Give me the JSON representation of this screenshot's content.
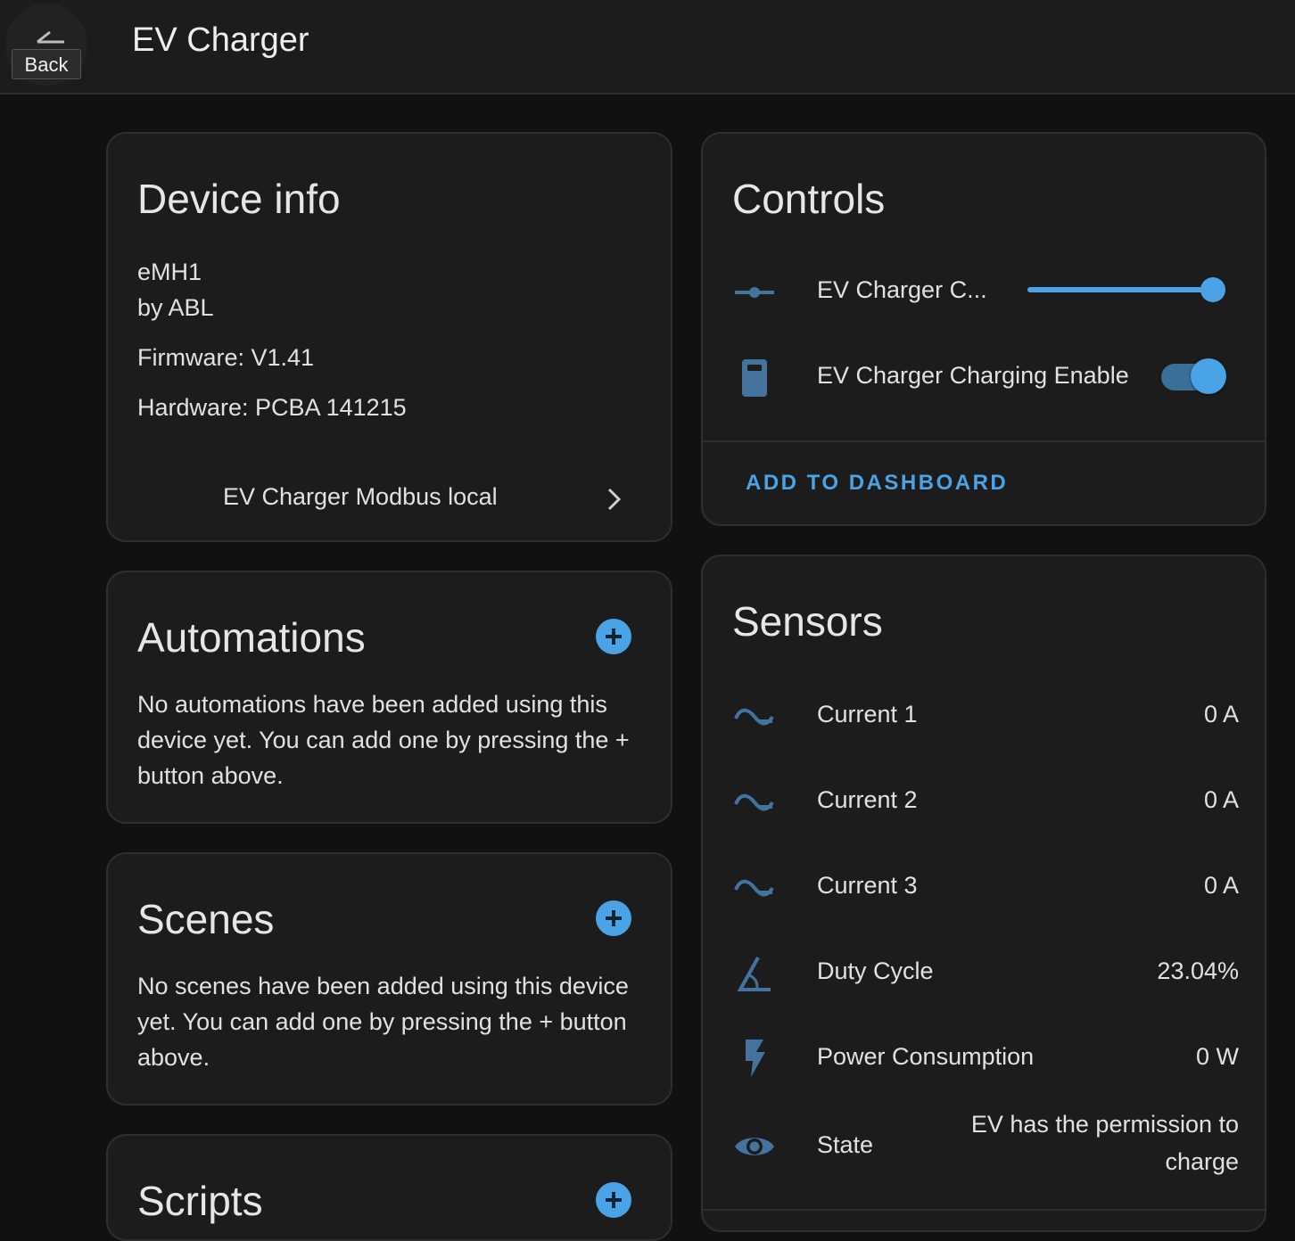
{
  "header": {
    "back_label": "Back",
    "title": "EV Charger"
  },
  "device_info": {
    "title": "Device info",
    "model": "eMH1",
    "manufacturer": "by ABL",
    "firmware": "Firmware: V1.41",
    "hardware": "Hardware: PCBA 141215",
    "integration_link": "EV Charger Modbus local"
  },
  "automations": {
    "title": "Automations",
    "empty_text": "No automations have been added using this device yet. You can add one by pressing the + button above."
  },
  "scenes": {
    "title": "Scenes",
    "empty_text": "No scenes have been added using this device yet. You can add one by pressing the + button above."
  },
  "scripts": {
    "title": "Scripts"
  },
  "controls": {
    "title": "Controls",
    "items": [
      {
        "label": "EV Charger C...",
        "type": "slider",
        "icon": "slider-icon",
        "level": 1.0
      },
      {
        "label": "EV Charger Charging Enable",
        "type": "toggle",
        "icon": "charger-station-icon",
        "state": "on"
      }
    ],
    "add_to_dashboard": "ADD TO DASHBOARD"
  },
  "sensors": {
    "title": "Sensors",
    "items": [
      {
        "label": "Current 1",
        "value": "0 A",
        "icon": "current-ac-icon"
      },
      {
        "label": "Current 2",
        "value": "0 A",
        "icon": "current-ac-icon"
      },
      {
        "label": "Current 3",
        "value": "0 A",
        "icon": "current-ac-icon"
      },
      {
        "label": "Duty Cycle",
        "value": "23.04%",
        "icon": "angle-acute-icon"
      },
      {
        "label": "Power Consumption",
        "value": "0 W",
        "icon": "flash-icon"
      },
      {
        "label": "State",
        "value_line1": "EV has the permission to",
        "value_line2": "charge",
        "icon": "eye-icon"
      }
    ]
  },
  "colors": {
    "accent": "#4aa3e6",
    "icon": "#44739e",
    "card": "#1c1c1c",
    "background": "#111111"
  }
}
